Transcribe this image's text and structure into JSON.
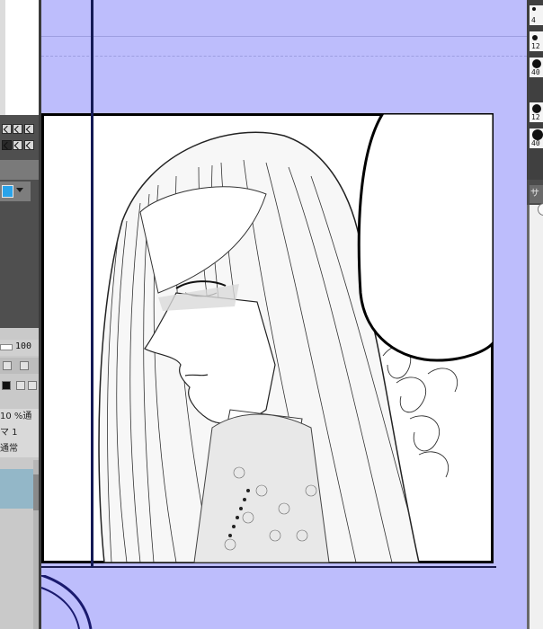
{
  "left_panel": {
    "opacity_value": "100",
    "layer_rows": [
      "10 %通",
      "マ 1",
      "通常"
    ]
  },
  "right_panel": {
    "brush_sizes": [
      "4",
      "12",
      "40",
      "12",
      "40"
    ],
    "size_tab_label": "サイ"
  },
  "colors": {
    "canvas_background": "#bdbdfc",
    "ruler_line": "#141a55",
    "main_color_swatch": "#29a3ea",
    "panel_border": "#000000",
    "layer_thumbnail": "#93b7c8"
  },
  "canvas": {
    "content": "manga illustration panel"
  }
}
